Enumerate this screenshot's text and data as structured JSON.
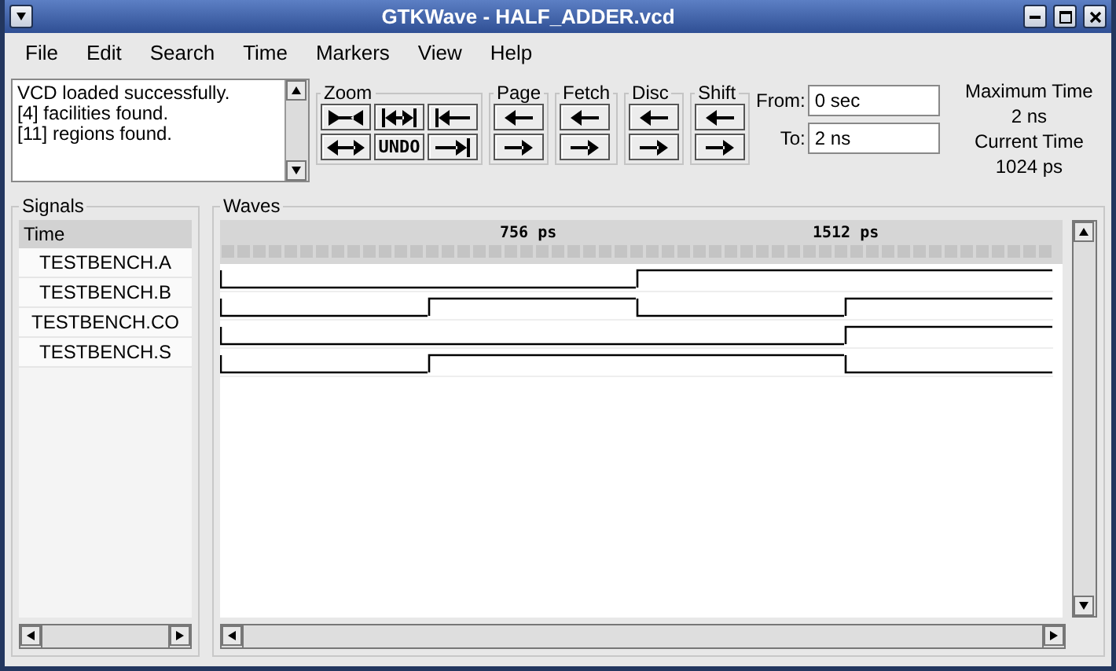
{
  "window": {
    "title": "GTKWave - HALF_ADDER.vcd"
  },
  "menu": [
    "File",
    "Edit",
    "Search",
    "Time",
    "Markers",
    "View",
    "Help"
  ],
  "messages": [
    "VCD loaded successfully.",
    "[4] facilities found.",
    "[11] regions found."
  ],
  "toolbar": {
    "groups": [
      {
        "label": "Zoom",
        "buttons": [
          {
            "kind": "zoom-fit"
          },
          {
            "kind": "zoom-in"
          },
          {
            "kind": "zoom-start"
          },
          {
            "kind": "zoom-out"
          },
          {
            "kind": "text",
            "label": "UNDO"
          },
          {
            "kind": "zoom-end"
          }
        ]
      },
      {
        "label": "Page",
        "buttons": [
          {
            "kind": "left"
          },
          {
            "kind": "right"
          }
        ]
      },
      {
        "label": "Fetch",
        "buttons": [
          {
            "kind": "left"
          },
          {
            "kind": "right"
          }
        ]
      },
      {
        "label": "Disc",
        "buttons": [
          {
            "kind": "left"
          },
          {
            "kind": "right"
          }
        ]
      },
      {
        "label": "Shift",
        "buttons": [
          {
            "kind": "left"
          },
          {
            "kind": "right"
          }
        ]
      }
    ],
    "from": {
      "label": "From:",
      "value": "0 sec"
    },
    "to": {
      "label": "To:",
      "value": "2 ns"
    },
    "times": [
      "Maximum Time",
      "2 ns",
      "Current Time",
      "1024 ps"
    ]
  },
  "signals": {
    "title": "Signals",
    "header": "Time",
    "items": [
      "TESTBENCH.A",
      "TESTBENCH.B",
      "TESTBENCH.CO",
      "TESTBENCH.S"
    ]
  },
  "waves": {
    "title": "Waves",
    "ticks": [
      "756 ps",
      "1512 ps"
    ],
    "traces": [
      {
        "high": [
          false,
          false,
          true,
          true
        ]
      },
      {
        "high": [
          false,
          true,
          false,
          true
        ]
      },
      {
        "high": [
          false,
          false,
          false,
          true
        ]
      },
      {
        "high": [
          false,
          true,
          true,
          false
        ]
      }
    ]
  }
}
